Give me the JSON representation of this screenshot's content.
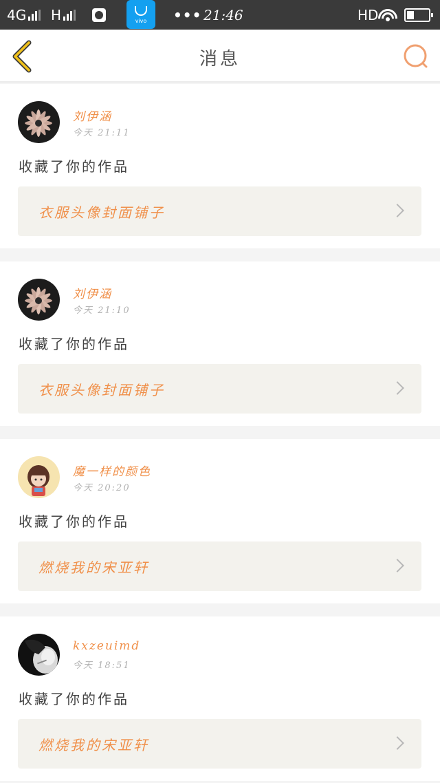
{
  "status_bar": {
    "network_4g": "4G",
    "network_h": "H",
    "vivo_label": "vivo",
    "dots": "•••",
    "time": "21:46",
    "hd": "HD"
  },
  "header": {
    "title": "消息",
    "back_icon": "chevron-left-icon",
    "search_icon": "search-icon",
    "accent_color": "#f0904a"
  },
  "messages": [
    {
      "username": "刘伊涵",
      "timestamp": "今天  21:11",
      "action": "收藏了你的作品",
      "work_title": "衣服头像封面铺子",
      "avatar": "flower-dark"
    },
    {
      "username": "刘伊涵",
      "timestamp": "今天  21:10",
      "action": "收藏了你的作品",
      "work_title": "衣服头像封面铺子",
      "avatar": "flower-dark"
    },
    {
      "username": "魔一样的颜色",
      "timestamp": "今天  20:20",
      "action": "收藏了你的作品",
      "work_title": "燃烧我的宋亚轩",
      "avatar": "cartoon-girl"
    },
    {
      "username": "kxzeuimd",
      "timestamp": "今天  18:51",
      "action": "收藏了你的作品",
      "work_title": "燃烧我的宋亚轩",
      "avatar": "bw-portrait"
    }
  ]
}
